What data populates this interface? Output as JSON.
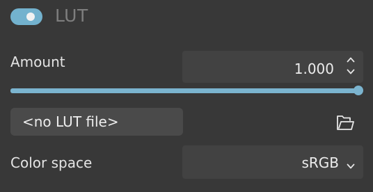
{
  "lut_section": {
    "enabled": true,
    "title": "LUT"
  },
  "amount": {
    "label": "Amount",
    "value": "1.000",
    "slider_fraction": 1.0
  },
  "lut_file": {
    "label": "<no LUT file>",
    "browse_icon": "folder-open-icon"
  },
  "color_space": {
    "label": "Color space",
    "selected": "sRGB",
    "icon": "chevron-down-icon"
  },
  "colors": {
    "accent": "#7bb4cf",
    "background": "#383838",
    "field": "#424242"
  }
}
